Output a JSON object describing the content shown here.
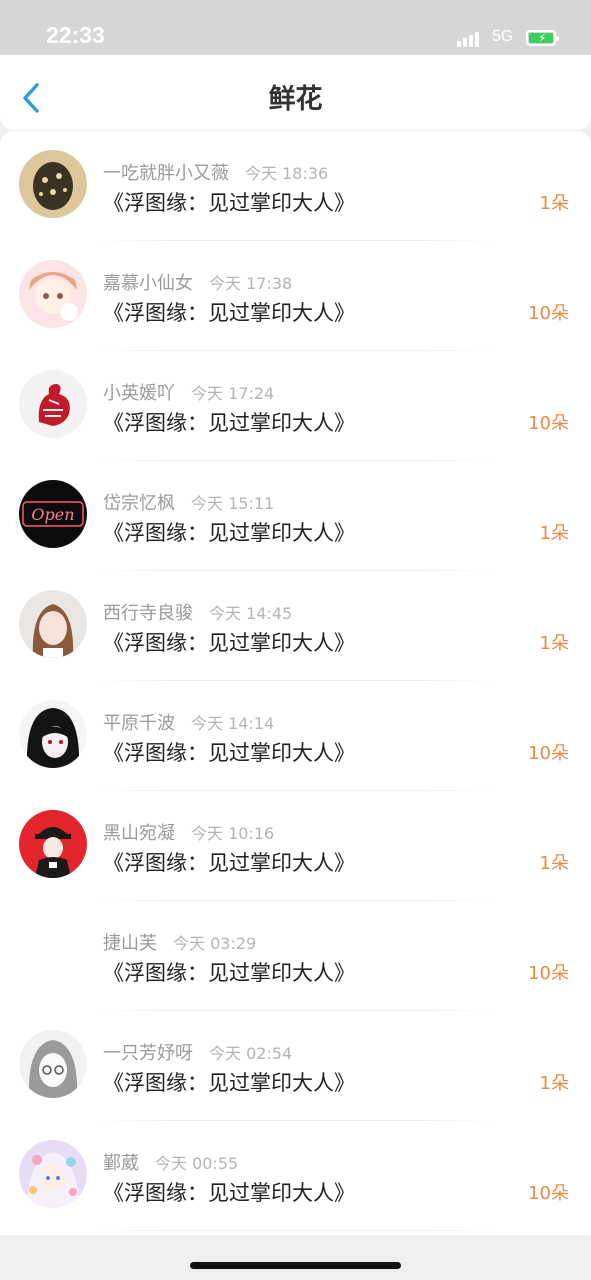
{
  "status_bar": {
    "time": "22:33",
    "network": "5G"
  },
  "nav": {
    "title": "鲜花"
  },
  "gifts": [
    {
      "user": "一吃就胖小又薇",
      "time": "今天 18:36",
      "book": "《浮图缘：见过掌印大人》",
      "count": "1朵"
    },
    {
      "user": "嘉慕小仙女",
      "time": "今天 17:38",
      "book": "《浮图缘：见过掌印大人》",
      "count": "10朵"
    },
    {
      "user": "小英媛吖",
      "time": "今天 17:24",
      "book": "《浮图缘：见过掌印大人》",
      "count": "10朵"
    },
    {
      "user": "岱宗忆枫",
      "time": "今天 15:11",
      "book": "《浮图缘：见过掌印大人》",
      "count": "1朵"
    },
    {
      "user": "西行寺良骏",
      "time": "今天 14:45",
      "book": "《浮图缘：见过掌印大人》",
      "count": "1朵"
    },
    {
      "user": "平原千波",
      "time": "今天 14:14",
      "book": "《浮图缘：见过掌印大人》",
      "count": "10朵"
    },
    {
      "user": "黑山宛凝",
      "time": "今天 10:16",
      "book": "《浮图缘：见过掌印大人》",
      "count": "1朵"
    },
    {
      "user": "捷山芙",
      "time": "今天 03:29",
      "book": "《浮图缘：见过掌印大人》",
      "count": "10朵"
    },
    {
      "user": "一只芳妤呀",
      "time": "今天 02:54",
      "book": "《浮图缘：见过掌印大人》",
      "count": "1朵"
    },
    {
      "user": "鄞葳",
      "time": "今天 00:55",
      "book": "《浮图缘：见过掌印大人》",
      "count": "10朵"
    }
  ],
  "colors": {
    "count": "#ea8a45",
    "back": "#2c9be6"
  }
}
